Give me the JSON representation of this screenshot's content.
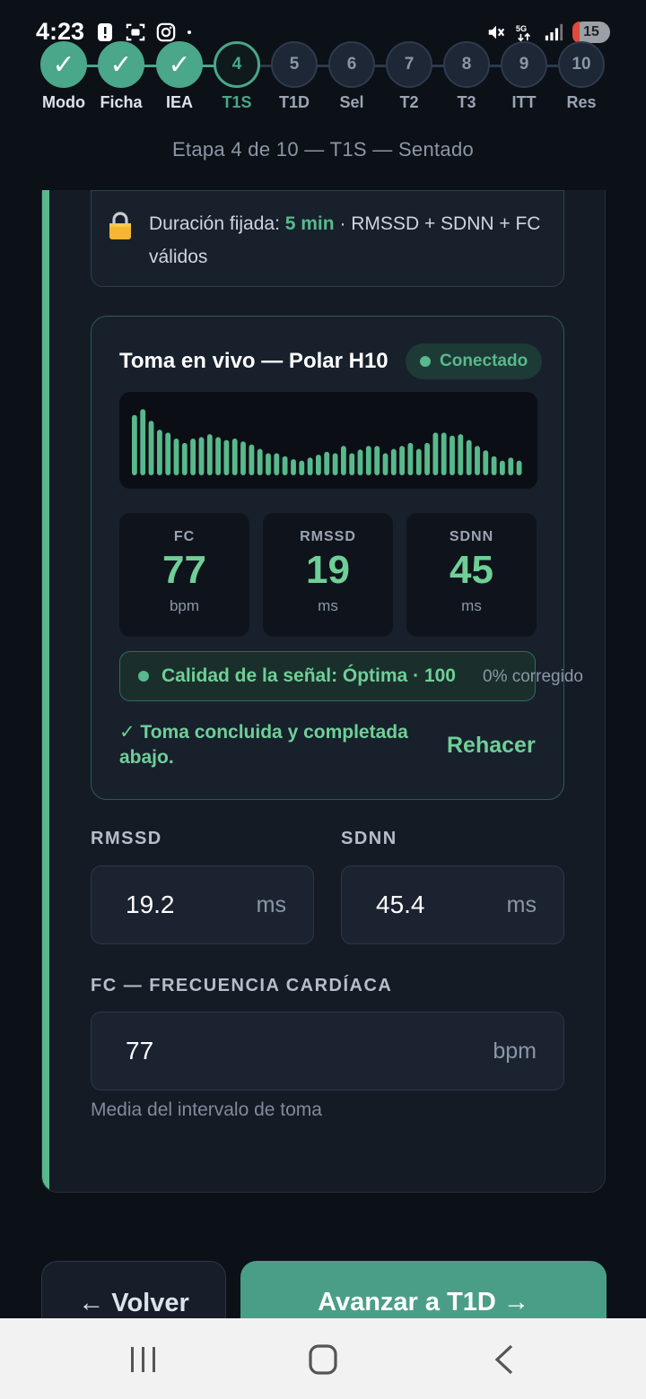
{
  "status_bar": {
    "time": "4:23",
    "battery": "15",
    "icons": [
      "alert-icon",
      "scan-icon",
      "instagram-icon",
      "dot-icon",
      "mute-icon",
      "5g-icon",
      "signal-icon",
      "battery-icon"
    ]
  },
  "stepper": {
    "steps": [
      {
        "num": "1",
        "label": "Modo",
        "state": "done"
      },
      {
        "num": "2",
        "label": "Ficha",
        "state": "done"
      },
      {
        "num": "3",
        "label": "IEA",
        "state": "done"
      },
      {
        "num": "4",
        "label": "T1S",
        "state": "current"
      },
      {
        "num": "5",
        "label": "T1D",
        "state": "pending"
      },
      {
        "num": "6",
        "label": "Sel",
        "state": "pending"
      },
      {
        "num": "7",
        "label": "T2",
        "state": "pending"
      },
      {
        "num": "8",
        "label": "T3",
        "state": "pending"
      },
      {
        "num": "9",
        "label": "ITT",
        "state": "pending"
      },
      {
        "num": "10",
        "label": "Res",
        "state": "pending"
      }
    ],
    "check": "✓",
    "caption": "Etapa 4 de 10 — T1S — Sentado"
  },
  "lock": {
    "prefix": "Duración fijada: ",
    "duration": "5 min",
    "suffix": " · RMSSD + SDNN + FC válidos"
  },
  "live": {
    "title": "Toma en vivo — Polar H10",
    "status": "Conectado",
    "waveform": [
      0.82,
      0.9,
      0.74,
      0.62,
      0.58,
      0.5,
      0.44,
      0.5,
      0.52,
      0.56,
      0.52,
      0.48,
      0.5,
      0.46,
      0.42,
      0.36,
      0.3,
      0.3,
      0.26,
      0.22,
      0.2,
      0.24,
      0.28,
      0.32,
      0.3,
      0.4,
      0.3,
      0.35,
      0.4,
      0.4,
      0.3,
      0.36,
      0.4,
      0.44,
      0.36,
      0.44,
      0.58,
      0.58,
      0.54,
      0.56,
      0.48,
      0.4,
      0.34,
      0.26,
      0.2,
      0.24,
      0.2
    ],
    "metrics": [
      {
        "name": "FC",
        "value": "77",
        "unit": "bpm"
      },
      {
        "name": "RMSSD",
        "value": "19",
        "unit": "ms"
      },
      {
        "name": "SDNN",
        "value": "45",
        "unit": "ms"
      }
    ],
    "quality": "Calidad de la señal: Óptima · 100",
    "quality_sub": "0% corregido",
    "done_message": "✓ Toma concluida y completada abajo.",
    "redo": "Rehacer"
  },
  "fields": {
    "rmssd": {
      "label": "RMSSD",
      "value": "19.2",
      "unit": "ms"
    },
    "sdnn": {
      "label": "SDNN",
      "value": "45.4",
      "unit": "ms"
    },
    "fc": {
      "label": "FC — FRECUENCIA CARDÍACA",
      "value": "77",
      "unit": "bpm",
      "hint": "Media del intervalo de toma"
    }
  },
  "buttons": {
    "back": "← Volver",
    "next": "Avanzar a T1D →"
  },
  "colors": {
    "accent": "#58b98c",
    "background": "#0c1017"
  }
}
